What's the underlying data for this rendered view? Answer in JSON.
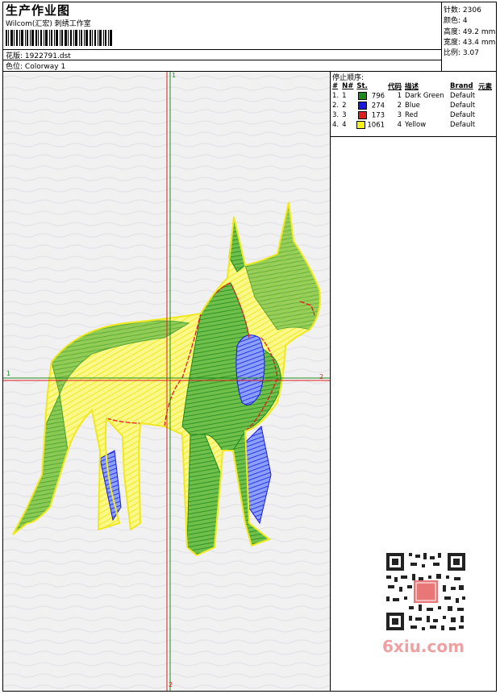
{
  "header": {
    "title": "生产作业图",
    "studio": "Wilcom(汇宏) 刺绣工作室",
    "design_label": "花版:",
    "design_file": "1922791.dst",
    "colorway_label": "色位:",
    "colorway": "Colorway 1"
  },
  "stats": [
    {
      "label": "针数:",
      "value": "2306"
    },
    {
      "label": "颜色:",
      "value": "4"
    },
    {
      "label": "高度:",
      "value": "49.2 mm"
    },
    {
      "label": "宽度:",
      "value": "43.4 mm"
    },
    {
      "label": "比例:",
      "value": "3.07"
    }
  ],
  "stop_sequence": {
    "title": "停止顺序:",
    "columns": [
      "#",
      "N#",
      "St.",
      "代码",
      "描述",
      "Brand",
      "元素"
    ],
    "rows": [
      {
        "num": "1.",
        "n": "1",
        "color": "#1e8a1e",
        "stitches": "796",
        "code": "1",
        "desc": "Dark Green",
        "brand": "Default"
      },
      {
        "num": "2.",
        "n": "2",
        "color": "#1a1adc",
        "stitches": "274",
        "code": "2",
        "desc": "Blue",
        "brand": "Default"
      },
      {
        "num": "3.",
        "n": "3",
        "color": "#dc1e1e",
        "stitches": "173",
        "code": "3",
        "desc": "Red",
        "brand": "Default"
      },
      {
        "num": "4.",
        "n": "4",
        "color": "#f5f01e",
        "stitches": "1061",
        "code": "4",
        "desc": "Yellow",
        "brand": "Default"
      }
    ]
  },
  "axes": {
    "h_start": "1",
    "h_end": "2",
    "v_start": "1",
    "v_end": "2"
  },
  "watermark": "6xiu.com"
}
